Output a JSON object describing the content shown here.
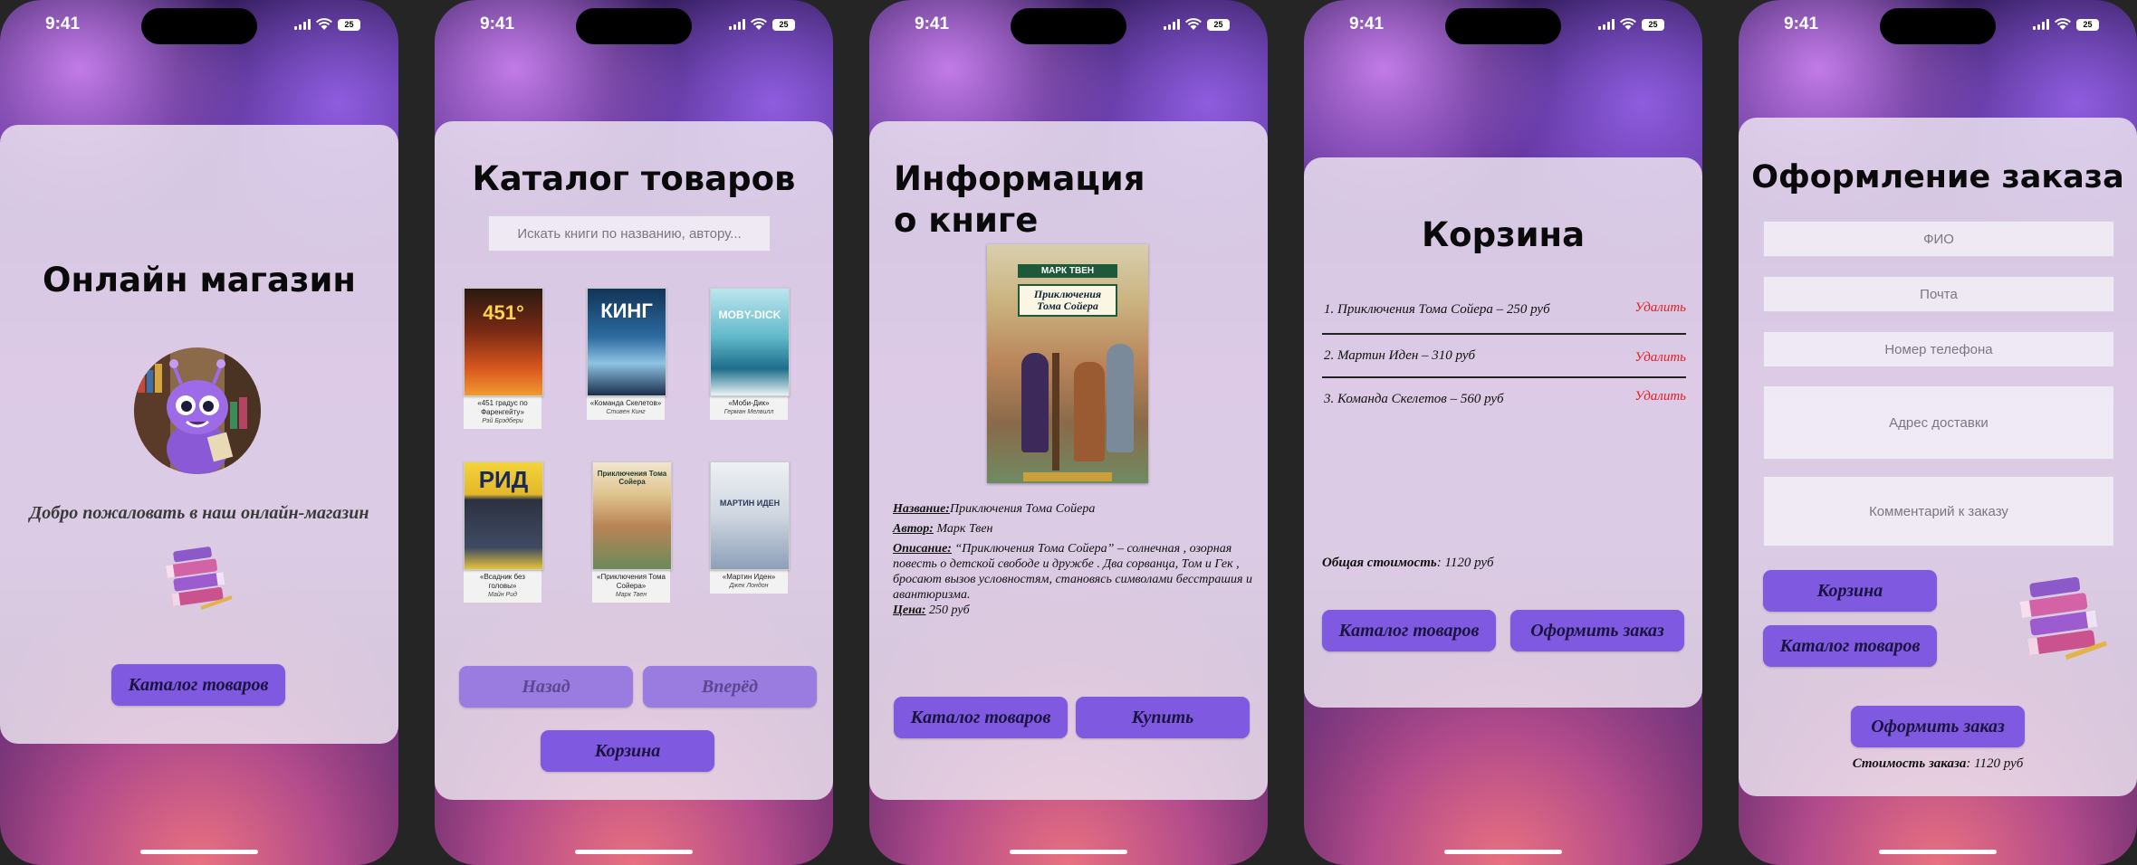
{
  "status": {
    "time": "9:41",
    "battery": "25"
  },
  "screen1": {
    "title": "Онлайн магазин",
    "welcome": "Добро пожаловать в наш онлайн-магазин",
    "catalog_button": "Каталог товаров"
  },
  "screen2": {
    "title": "Каталог товаров",
    "search_placeholder": "Искать книги по названию, автору...",
    "books": [
      {
        "title": "«451 градус по Фаренгейту»",
        "author": "Рэй Брэдбери",
        "cover_text": "451°",
        "color": "#b5421d"
      },
      {
        "title": "«Команда Скелетов»",
        "author": "Стивен Кинг",
        "cover_text": "КИНГ",
        "color": "#2c5a8e"
      },
      {
        "title": "«Моби-Дик»",
        "author": "Герман Мелвилл",
        "cover_text": "MOBY-DICK",
        "color": "#3fa4b8"
      },
      {
        "title": "«Всадник без головы»",
        "author": "Майн Рид",
        "cover_text": "РИД",
        "color": "#e5c530"
      },
      {
        "title": "«Приключения Тома Сойера»",
        "author": "Марк Твен",
        "cover_text": "Приключения Тома Сойера",
        "color": "#c49a6c"
      },
      {
        "title": "«Мартин Иден»",
        "author": "Джек Лондон",
        "cover_text": "МАРТИН ИДЕН",
        "color": "#d7dde6"
      }
    ],
    "back_button": "Назад",
    "forward_button": "Вперёд",
    "cart_button": "Корзина"
  },
  "screen3": {
    "title_line1": "Информация",
    "title_line2": "о книге",
    "cover_author": "МАРК ТВЕН",
    "cover_title": "Приключения Тома Сойера",
    "name_label": "Название:",
    "name_value": "Приключения Тома Сойера",
    "author_label": "Автор:",
    "author_value": "Марк Твен",
    "desc_label": "Описание:",
    "desc_value": "“Приключения Тома Сойера” – солнечная , озорная повесть о детской свободе и дружбе . Два сорванца, Том и Гек , бросают вызов условностям, становясь символами бесстрашия и авантюризма.",
    "price_label": "Цена:",
    "price_value": "250 руб",
    "catalog_button": "Каталог товаров",
    "buy_button": "Купить"
  },
  "screen4": {
    "title": "Корзина",
    "items": [
      {
        "text": "1. Приключения Тома Сойера – 250 руб",
        "action": "Удалить"
      },
      {
        "text": "2. Мартин Иден – 310 руб",
        "action": "Удалить"
      },
      {
        "text": "3. Команда Скелетов – 560 руб",
        "action": "Удалить"
      }
    ],
    "total_label": "Общая стоимость",
    "total_value": ": 1120 руб",
    "catalog_button": "Каталог товаров",
    "checkout_button": "Оформить заказ"
  },
  "screen5": {
    "title": "Оформление заказа",
    "fields": {
      "name": "ФИО",
      "email": "Почта",
      "phone": "Номер телефона",
      "address": "Адрес доставки",
      "comment": "Комментарий к заказу"
    },
    "cart_button": "Корзина",
    "catalog_button": "Каталог товаров",
    "checkout_button": "Оформить заказ",
    "total_label": "Стоимость заказа",
    "total_value": ": 1120 руб"
  }
}
